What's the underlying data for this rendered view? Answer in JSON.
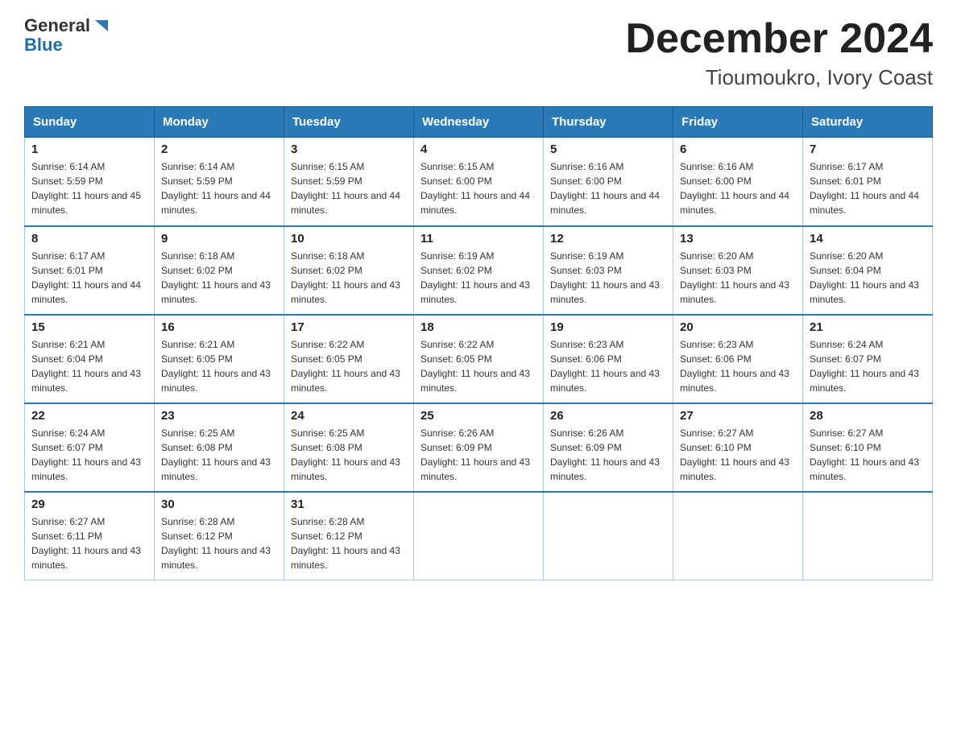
{
  "header": {
    "logo_line1": "General",
    "logo_line2": "Blue",
    "title": "December 2024",
    "subtitle": "Tioumoukro, Ivory Coast"
  },
  "days_of_week": [
    "Sunday",
    "Monday",
    "Tuesday",
    "Wednesday",
    "Thursday",
    "Friday",
    "Saturday"
  ],
  "weeks": [
    [
      {
        "day": "1",
        "sunrise": "6:14 AM",
        "sunset": "5:59 PM",
        "daylight": "11 hours and 45 minutes."
      },
      {
        "day": "2",
        "sunrise": "6:14 AM",
        "sunset": "5:59 PM",
        "daylight": "11 hours and 44 minutes."
      },
      {
        "day": "3",
        "sunrise": "6:15 AM",
        "sunset": "5:59 PM",
        "daylight": "11 hours and 44 minutes."
      },
      {
        "day": "4",
        "sunrise": "6:15 AM",
        "sunset": "6:00 PM",
        "daylight": "11 hours and 44 minutes."
      },
      {
        "day": "5",
        "sunrise": "6:16 AM",
        "sunset": "6:00 PM",
        "daylight": "11 hours and 44 minutes."
      },
      {
        "day": "6",
        "sunrise": "6:16 AM",
        "sunset": "6:00 PM",
        "daylight": "11 hours and 44 minutes."
      },
      {
        "day": "7",
        "sunrise": "6:17 AM",
        "sunset": "6:01 PM",
        "daylight": "11 hours and 44 minutes."
      }
    ],
    [
      {
        "day": "8",
        "sunrise": "6:17 AM",
        "sunset": "6:01 PM",
        "daylight": "11 hours and 44 minutes."
      },
      {
        "day": "9",
        "sunrise": "6:18 AM",
        "sunset": "6:02 PM",
        "daylight": "11 hours and 43 minutes."
      },
      {
        "day": "10",
        "sunrise": "6:18 AM",
        "sunset": "6:02 PM",
        "daylight": "11 hours and 43 minutes."
      },
      {
        "day": "11",
        "sunrise": "6:19 AM",
        "sunset": "6:02 PM",
        "daylight": "11 hours and 43 minutes."
      },
      {
        "day": "12",
        "sunrise": "6:19 AM",
        "sunset": "6:03 PM",
        "daylight": "11 hours and 43 minutes."
      },
      {
        "day": "13",
        "sunrise": "6:20 AM",
        "sunset": "6:03 PM",
        "daylight": "11 hours and 43 minutes."
      },
      {
        "day": "14",
        "sunrise": "6:20 AM",
        "sunset": "6:04 PM",
        "daylight": "11 hours and 43 minutes."
      }
    ],
    [
      {
        "day": "15",
        "sunrise": "6:21 AM",
        "sunset": "6:04 PM",
        "daylight": "11 hours and 43 minutes."
      },
      {
        "day": "16",
        "sunrise": "6:21 AM",
        "sunset": "6:05 PM",
        "daylight": "11 hours and 43 minutes."
      },
      {
        "day": "17",
        "sunrise": "6:22 AM",
        "sunset": "6:05 PM",
        "daylight": "11 hours and 43 minutes."
      },
      {
        "day": "18",
        "sunrise": "6:22 AM",
        "sunset": "6:05 PM",
        "daylight": "11 hours and 43 minutes."
      },
      {
        "day": "19",
        "sunrise": "6:23 AM",
        "sunset": "6:06 PM",
        "daylight": "11 hours and 43 minutes."
      },
      {
        "day": "20",
        "sunrise": "6:23 AM",
        "sunset": "6:06 PM",
        "daylight": "11 hours and 43 minutes."
      },
      {
        "day": "21",
        "sunrise": "6:24 AM",
        "sunset": "6:07 PM",
        "daylight": "11 hours and 43 minutes."
      }
    ],
    [
      {
        "day": "22",
        "sunrise": "6:24 AM",
        "sunset": "6:07 PM",
        "daylight": "11 hours and 43 minutes."
      },
      {
        "day": "23",
        "sunrise": "6:25 AM",
        "sunset": "6:08 PM",
        "daylight": "11 hours and 43 minutes."
      },
      {
        "day": "24",
        "sunrise": "6:25 AM",
        "sunset": "6:08 PM",
        "daylight": "11 hours and 43 minutes."
      },
      {
        "day": "25",
        "sunrise": "6:26 AM",
        "sunset": "6:09 PM",
        "daylight": "11 hours and 43 minutes."
      },
      {
        "day": "26",
        "sunrise": "6:26 AM",
        "sunset": "6:09 PM",
        "daylight": "11 hours and 43 minutes."
      },
      {
        "day": "27",
        "sunrise": "6:27 AM",
        "sunset": "6:10 PM",
        "daylight": "11 hours and 43 minutes."
      },
      {
        "day": "28",
        "sunrise": "6:27 AM",
        "sunset": "6:10 PM",
        "daylight": "11 hours and 43 minutes."
      }
    ],
    [
      {
        "day": "29",
        "sunrise": "6:27 AM",
        "sunset": "6:11 PM",
        "daylight": "11 hours and 43 minutes."
      },
      {
        "day": "30",
        "sunrise": "6:28 AM",
        "sunset": "6:12 PM",
        "daylight": "11 hours and 43 minutes."
      },
      {
        "day": "31",
        "sunrise": "6:28 AM",
        "sunset": "6:12 PM",
        "daylight": "11 hours and 43 minutes."
      },
      null,
      null,
      null,
      null
    ]
  ]
}
